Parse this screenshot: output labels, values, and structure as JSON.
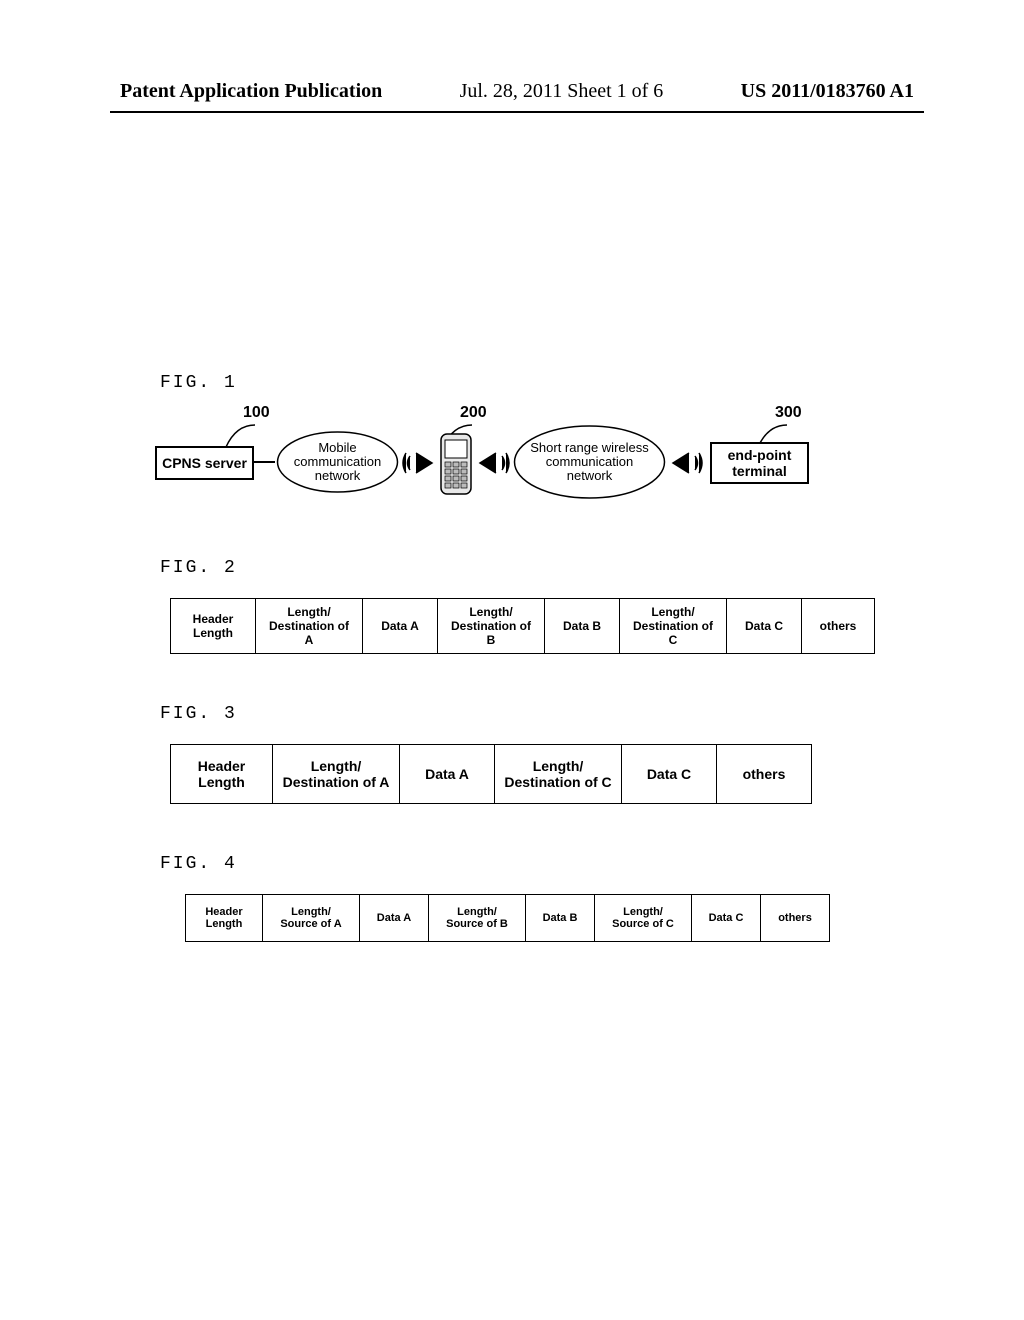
{
  "header": {
    "left": "Patent Application Publication",
    "mid": "Jul. 28, 2011  Sheet 1 of 6",
    "right": "US 2011/0183760 A1"
  },
  "fig1": {
    "label": "FIG. 1",
    "num_cpns": "100",
    "num_phone": "200",
    "num_endpoint": "300",
    "box_cpns": "CPNS server",
    "cloud_mobile": "Mobile communication network",
    "cloud_short": "Short range wireless communication network",
    "box_endpoint": "end-point terminal"
  },
  "fig2": {
    "label": "FIG. 2",
    "cells": [
      "Header Length",
      "Length/\nDestination of A",
      "Data A",
      "Length/\nDestination of B",
      "Data B",
      "Length/\nDestination of C",
      "Data C",
      "others"
    ]
  },
  "fig3": {
    "label": "FIG. 3",
    "cells": [
      "Header Length",
      "Length/\nDestination of A",
      "Data A",
      "Length/\nDestination of C",
      "Data C",
      "others"
    ]
  },
  "fig4": {
    "label": "FIG. 4",
    "cells": [
      "Header Length",
      "Length/\nSource of A",
      "Data A",
      "Length/\nSource of B",
      "Data B",
      "Length/\nSource of C",
      "Data C",
      "others"
    ]
  }
}
